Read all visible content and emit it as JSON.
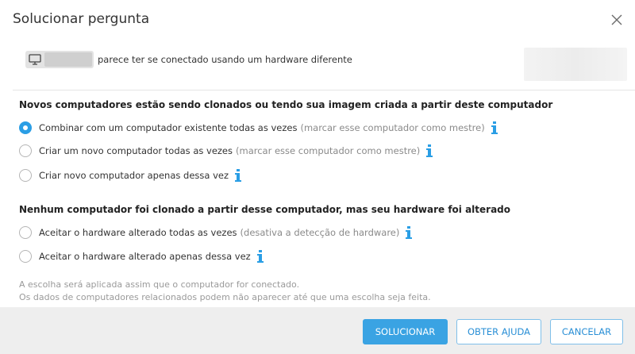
{
  "dialog": {
    "title": "Solucionar pergunta",
    "close_icon": "close-icon"
  },
  "device": {
    "icon": "monitor-icon",
    "text": "parece ter se conectado usando um hardware diferente"
  },
  "section_cloned": {
    "title": "Novos computadores estão sendo clonados ou tendo sua imagem criada a partir deste computador",
    "options": [
      {
        "label": "Combinar com um computador existente todas as vezes",
        "hint": "(marcar esse computador como mestre)",
        "checked": true
      },
      {
        "label": "Criar um novo computador todas as vezes",
        "hint": "(marcar esse computador como mestre)",
        "checked": false
      },
      {
        "label": "Criar novo computador apenas dessa vez",
        "hint": "",
        "checked": false
      }
    ]
  },
  "section_hardware": {
    "title": "Nenhum computador foi clonado a partir desse computador, mas seu hardware foi alterado",
    "options": [
      {
        "label": "Aceitar o hardware alterado todas as vezes",
        "hint": "(desativa a detecção de hardware)",
        "checked": false
      },
      {
        "label": "Aceitar o hardware alterado apenas dessa vez",
        "hint": "",
        "checked": false
      }
    ]
  },
  "footnote": {
    "line1": "A escolha será aplicada assim que o computador for conectado.",
    "line2": "Os dados de computadores relacionados podem não aparecer até que uma escolha seja feita."
  },
  "buttons": {
    "resolve": "SOLUCIONAR",
    "help": "OBTER AJUDA",
    "cancel": "CANCELAR"
  },
  "colors": {
    "accent": "#3aa3e3",
    "info_icon": "#2a9ee5",
    "footer_bg": "#eeeeee"
  }
}
